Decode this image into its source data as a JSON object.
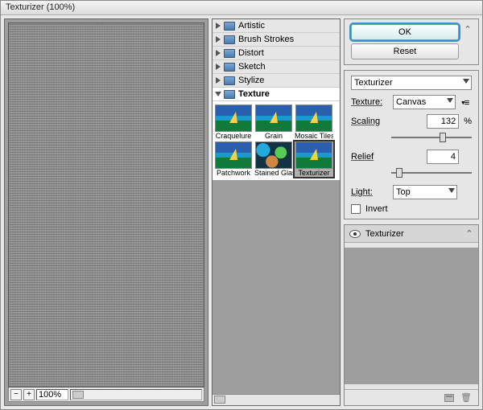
{
  "window": {
    "title": "Texturizer (100%)"
  },
  "preview": {
    "zoom": "100%"
  },
  "categories": [
    {
      "name": "Artistic",
      "open": false
    },
    {
      "name": "Brush Strokes",
      "open": false
    },
    {
      "name": "Distort",
      "open": false
    },
    {
      "name": "Sketch",
      "open": false
    },
    {
      "name": "Stylize",
      "open": false
    },
    {
      "name": "Texture",
      "open": true
    }
  ],
  "texture_items": [
    {
      "name": "Craquelure"
    },
    {
      "name": "Grain"
    },
    {
      "name": "Mosaic Tiles"
    },
    {
      "name": "Patchwork"
    },
    {
      "name": "Stained Glass"
    },
    {
      "name": "Texturizer",
      "selected": true
    }
  ],
  "controls": {
    "ok": "OK",
    "reset": "Reset",
    "filter": "Texturizer",
    "texture_label": "Texture:",
    "texture_value": "Canvas",
    "scaling_label": "Scaling",
    "scaling_value": "132",
    "scaling_unit": "%",
    "relief_label": "Relief",
    "relief_value": "4",
    "light_label": "Light:",
    "light_value": "Top",
    "invert_label": "Invert"
  },
  "effects": {
    "current": "Texturizer"
  }
}
